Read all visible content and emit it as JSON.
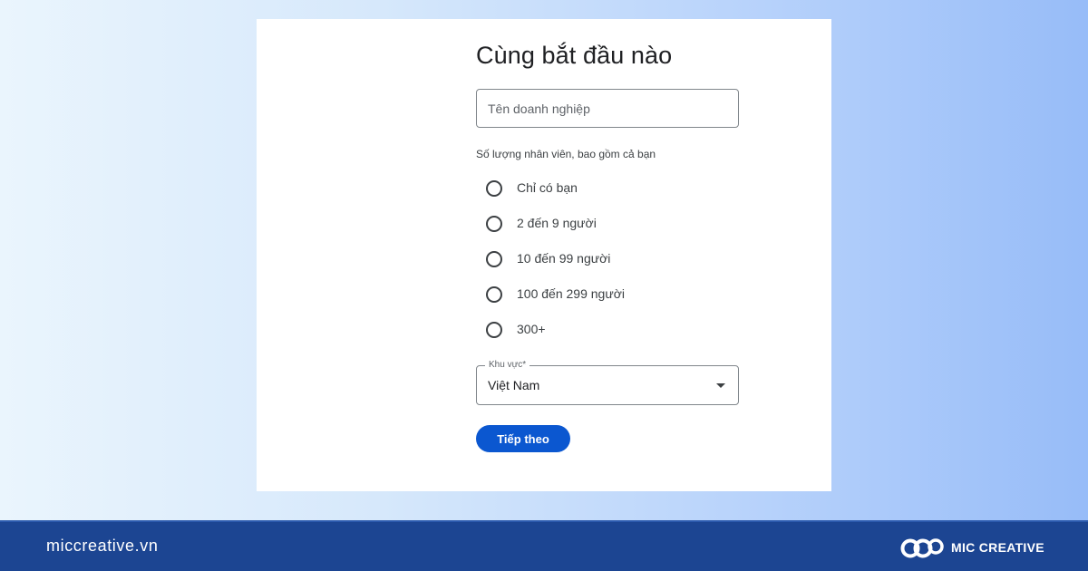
{
  "form": {
    "title": "Cùng bắt đầu nào",
    "business_name": {
      "placeholder": "Tên doanh nghiệp",
      "value": ""
    },
    "employee_count": {
      "label": "Số lượng nhân viên, bao gồm cả bạn",
      "options": [
        "Chỉ có bạn",
        "2 đến 9 người",
        "10 đến 99 người",
        "100 đến 299 người",
        "300+"
      ],
      "selected": null
    },
    "region": {
      "label": "Khu vực*",
      "value": "Việt Nam"
    },
    "next_label": "Tiếp theo"
  },
  "footer": {
    "url": "miccreative.vn",
    "brand": "MIC CREATIVE"
  },
  "colors": {
    "primary_button": "#0b57d0",
    "footer_background": "#1c4592",
    "page_gradient_start": "#eaf5fd",
    "page_gradient_end": "#97bcf8"
  },
  "icons": {
    "dropdown": "arrow-drop-down-icon",
    "brand_logo": "mic-creative-logo"
  }
}
